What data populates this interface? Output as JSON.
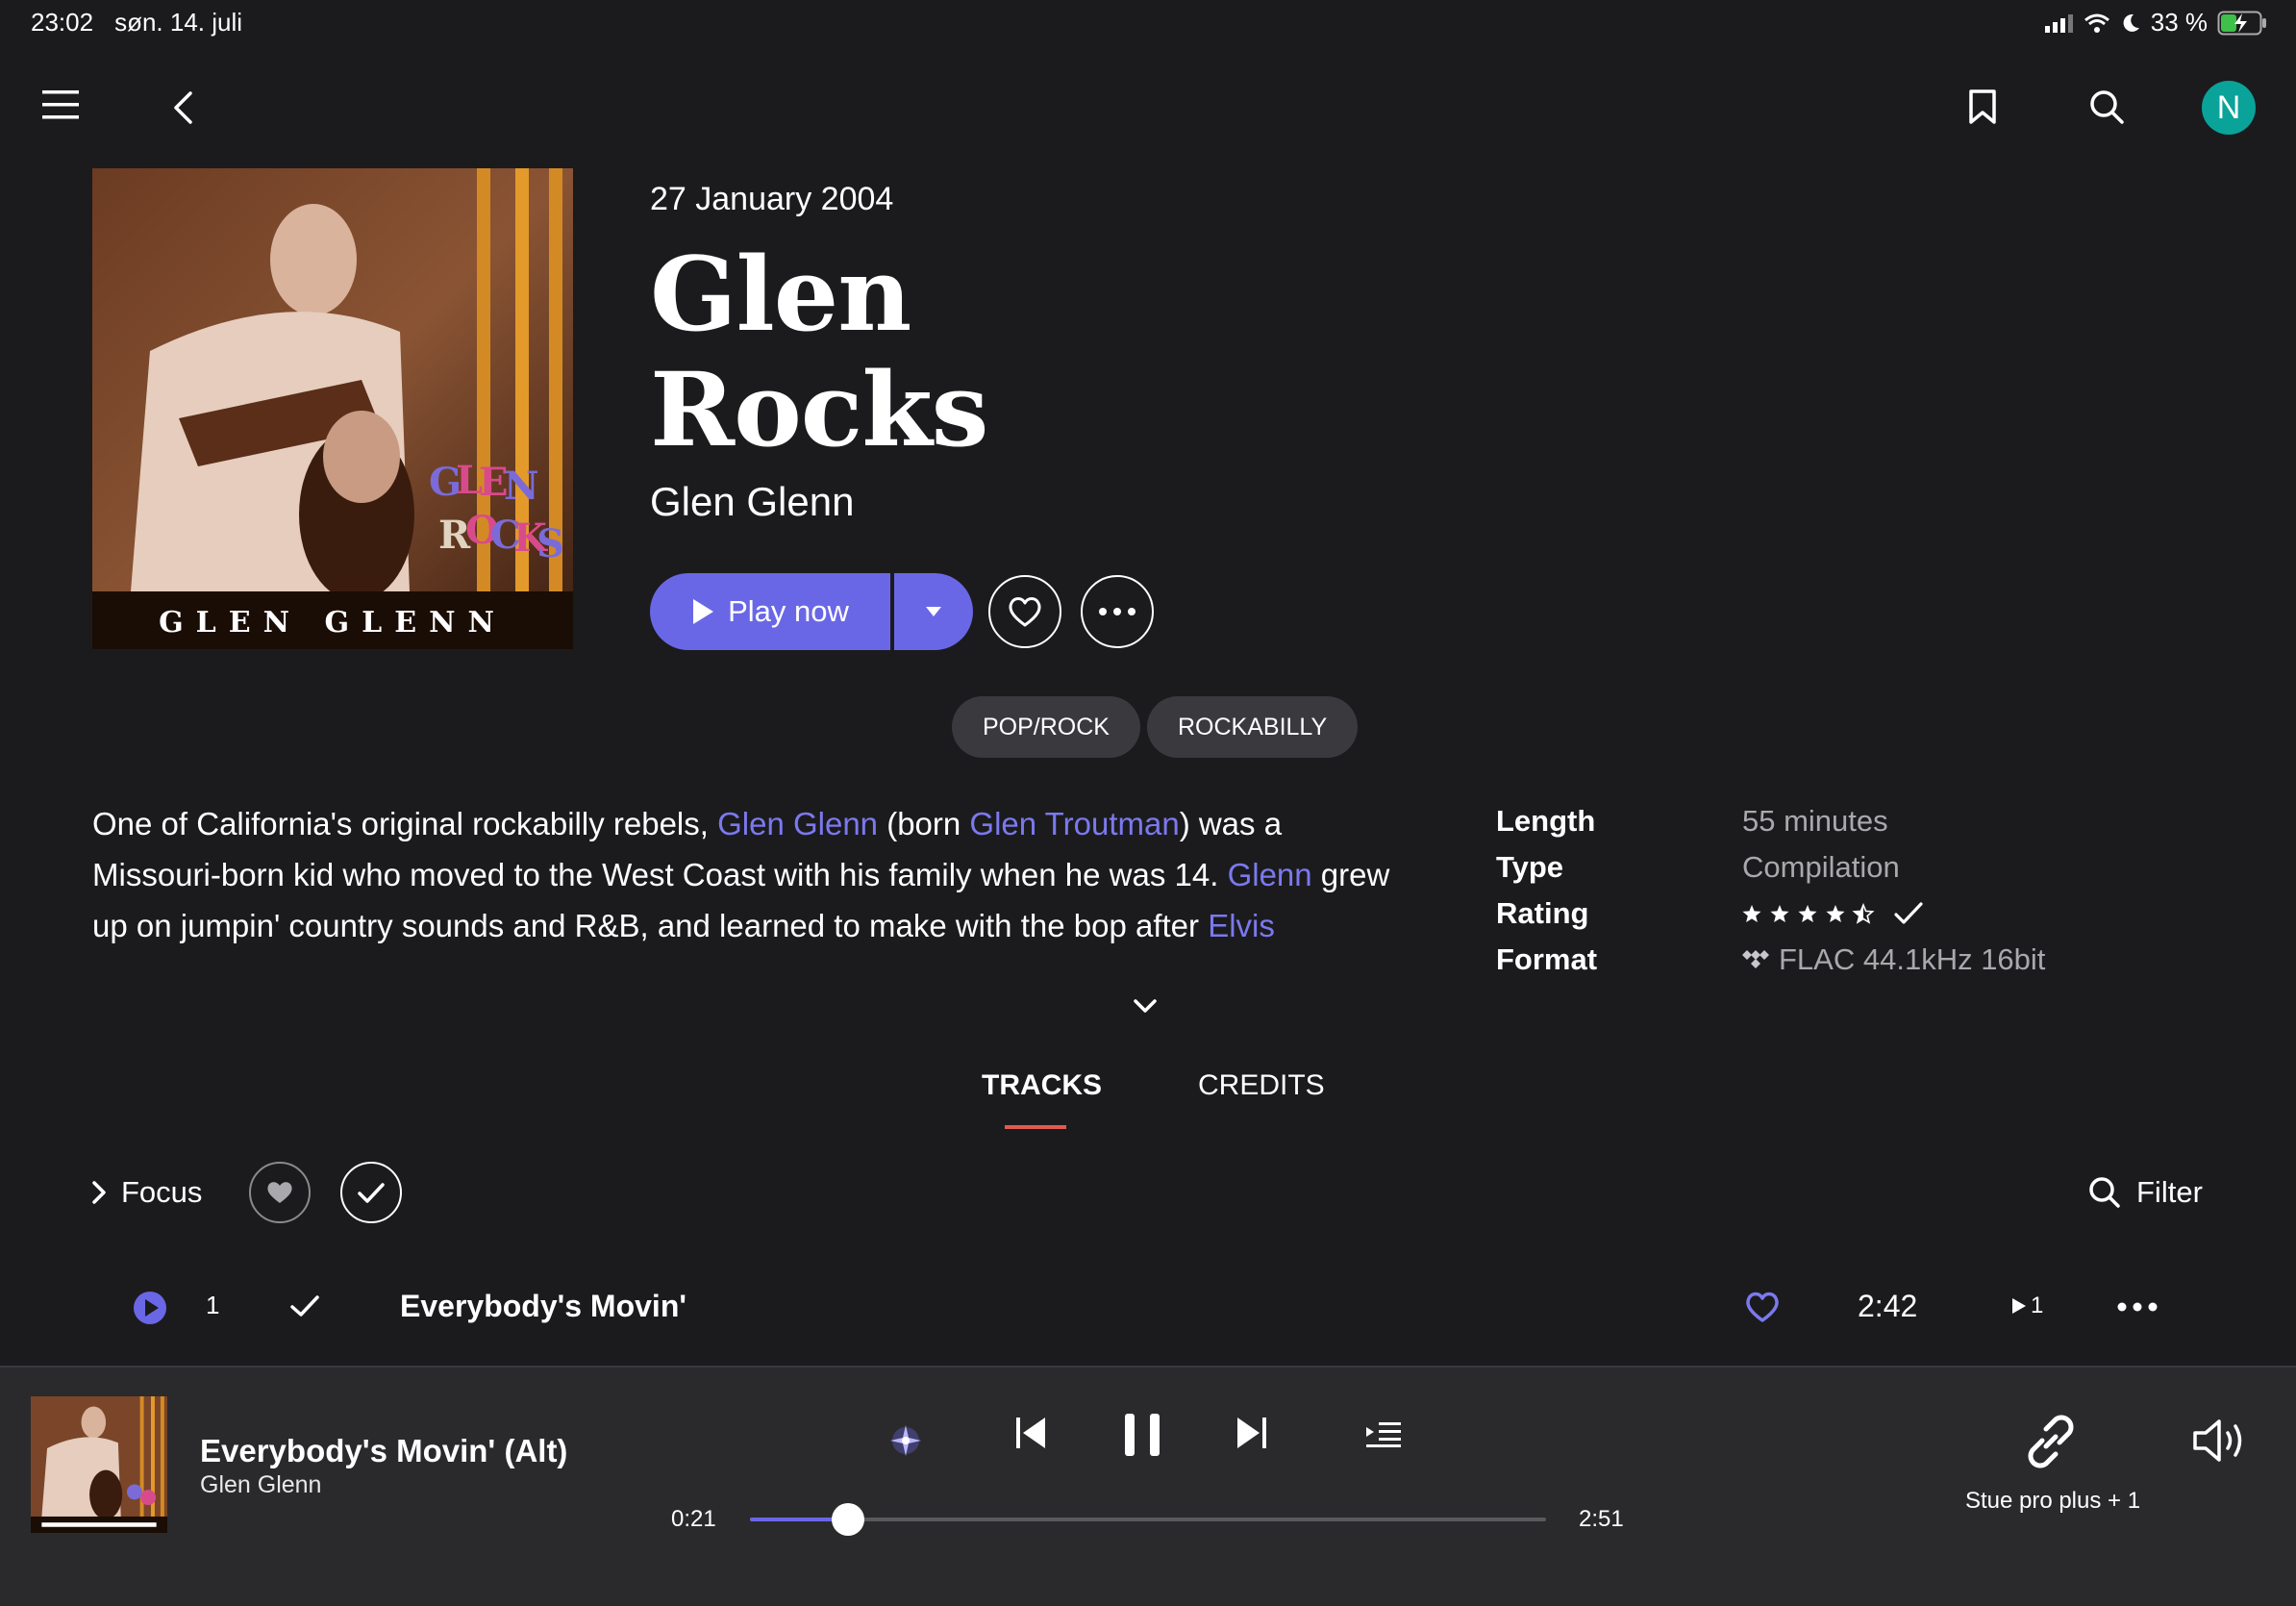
{
  "status_bar": {
    "time": "23:02",
    "date": "søn. 14. juli",
    "battery": "33 %"
  },
  "nav": {
    "avatar_initial": "N"
  },
  "album": {
    "release_date": "27 January 2004",
    "title_line1": "Glen",
    "title_line2": "Rocks",
    "artist": "Glen Glenn",
    "cover_text": "GLEN GLENN",
    "cover_logo": "GLEN ROCKS"
  },
  "actions": {
    "play_label": "Play now"
  },
  "genres": [
    "POP/ROCK",
    "ROCKABILLY"
  ],
  "description": {
    "t1": "One of California's original rockabilly rebels, ",
    "l1": "Glen Glenn",
    "t2": " (born ",
    "l2": "Glen Troutman",
    "t3": ") was a Missouri-born kid who moved to the West Coast with his family when he was 14. ",
    "l3": "Glenn",
    "t4": " grew up on jumpin' country sounds and R&B, and learned to make with the bop after ",
    "l4": "Elvis"
  },
  "meta": [
    {
      "label": "Length",
      "value": "55 minutes"
    },
    {
      "label": "Type",
      "value": "Compilation"
    },
    {
      "label": "Rating",
      "value": "4.5"
    },
    {
      "label": "Format",
      "value": "FLAC 44.1kHz 16bit"
    }
  ],
  "tabs": [
    {
      "label": "TRACKS",
      "active": true
    },
    {
      "label": "CREDITS",
      "active": false
    }
  ],
  "focus_label": "Focus",
  "filter_label": "Filter",
  "tracks": [
    {
      "number": "1",
      "title": "Everybody's Movin'",
      "duration": "2:42",
      "plays": "1"
    }
  ],
  "now_playing": {
    "title": "Everybody's Movin' (Alt)",
    "artist": "Glen Glenn",
    "elapsed": "0:21",
    "total": "2:51",
    "progress": 0.123,
    "device": "Stue pro plus + 1"
  },
  "colors": {
    "accent": "#6a67e6",
    "link": "#7b79ee",
    "tab_underline": "#e05a4d",
    "avatar": "#0aa39a"
  }
}
